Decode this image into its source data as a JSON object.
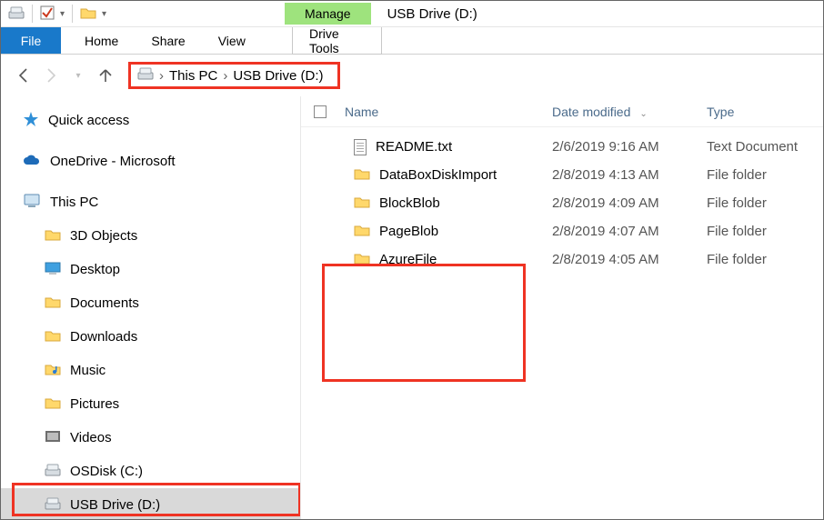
{
  "title_bar": {
    "context_label": "Manage",
    "window_title": "USB Drive (D:)"
  },
  "ribbon": {
    "file": "File",
    "home": "Home",
    "share": "Share",
    "view": "View",
    "drive_tools": "Drive Tools"
  },
  "breadcrumbs": {
    "root": "This PC",
    "leaf": "USB Drive (D:)"
  },
  "sidebar": {
    "quick_access": "Quick access",
    "onedrive": "OneDrive - Microsoft",
    "this_pc": "This PC",
    "items": {
      "objects3d": "3D Objects",
      "desktop": "Desktop",
      "documents": "Documents",
      "downloads": "Downloads",
      "music": "Music",
      "pictures": "Pictures",
      "videos": "Videos",
      "osdisk": "OSDisk (C:)",
      "usb": "USB Drive (D:)"
    }
  },
  "columns": {
    "name": "Name",
    "date": "Date modified",
    "type": "Type"
  },
  "files": [
    {
      "name": "README.txt",
      "date": "2/6/2019 9:16 AM",
      "type": "Text Document",
      "icon": "txt"
    },
    {
      "name": "DataBoxDiskImport",
      "date": "2/8/2019 4:13 AM",
      "type": "File folder",
      "icon": "folder"
    },
    {
      "name": "BlockBlob",
      "date": "2/8/2019 4:09 AM",
      "type": "File folder",
      "icon": "folder"
    },
    {
      "name": "PageBlob",
      "date": "2/8/2019 4:07 AM",
      "type": "File folder",
      "icon": "folder"
    },
    {
      "name": "AzureFile",
      "date": "2/8/2019 4:05 AM",
      "type": "File folder",
      "icon": "folder"
    }
  ]
}
